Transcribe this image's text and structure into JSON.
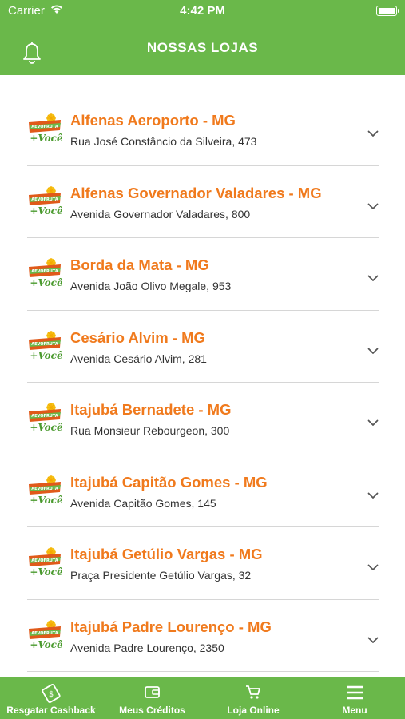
{
  "status": {
    "carrier": "Carrier",
    "time": "4:42 PM"
  },
  "header": {
    "title": "NOSSAS LOJAS"
  },
  "stores": [
    {
      "name": "Alfenas Aeroporto - MG",
      "address": "Rua José Constâncio da Silveira, 473"
    },
    {
      "name": "Alfenas Governador Valadares - MG",
      "address": "Avenida Governador Valadares, 800"
    },
    {
      "name": "Borda da Mata - MG",
      "address": "Avenida João Olivo Megale, 953"
    },
    {
      "name": "Cesário Alvim - MG",
      "address": "Avenida Cesário Alvim, 281"
    },
    {
      "name": "Itajubá Bernadete - MG",
      "address": "Rua Monsieur Rebourgeon, 300"
    },
    {
      "name": "Itajubá Capitão Gomes - MG",
      "address": "Avenida Capitão Gomes, 145"
    },
    {
      "name": "Itajubá Getúlio Vargas - MG",
      "address": "Praça Presidente Getúlio Vargas, 32"
    },
    {
      "name": "Itajubá Padre Lourenço - MG",
      "address": "Avenida Padre Lourenço, 2350"
    }
  ],
  "logo": {
    "top_text": "AEVOFRUTA",
    "bottom_text": "+Você"
  },
  "tabs": [
    {
      "label": "Resgatar Cashback",
      "icon": "cashback-icon"
    },
    {
      "label": "Meus Créditos",
      "icon": "wallet-icon"
    },
    {
      "label": "Loja Online",
      "icon": "cart-icon"
    },
    {
      "label": "Menu",
      "icon": "menu-icon"
    }
  ],
  "colors": {
    "brand_green": "#6ab84a",
    "store_orange": "#f07a1d"
  }
}
